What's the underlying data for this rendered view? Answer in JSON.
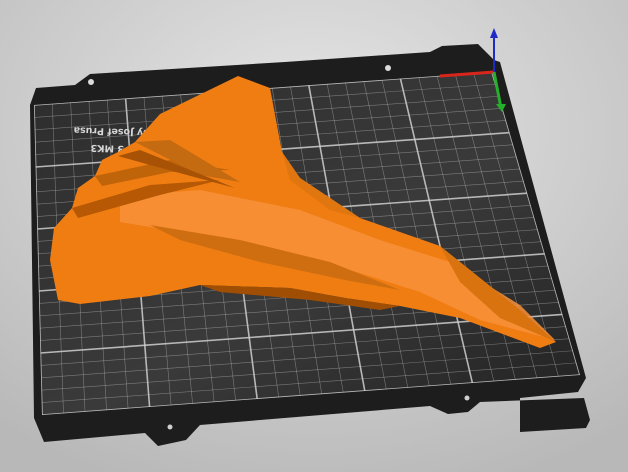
{
  "viewport": {
    "background_top": "#e2e2e2",
    "background_bottom": "#bcbcbc",
    "bed_color": "#262626",
    "grid_color": "#cfcfcf",
    "model_color": "#f07d12",
    "model_shadow": "#b85a06"
  },
  "bed": {
    "label_line1": "by Josef Prusa",
    "label_line2": "3 MK3"
  },
  "axes": {
    "x_color": "#d9261c",
    "y_color": "#25b02b",
    "z_color": "#1f2bc8"
  },
  "icons": {
    "axes": "xyz-axes-icon",
    "model": "3d-model-icon"
  }
}
